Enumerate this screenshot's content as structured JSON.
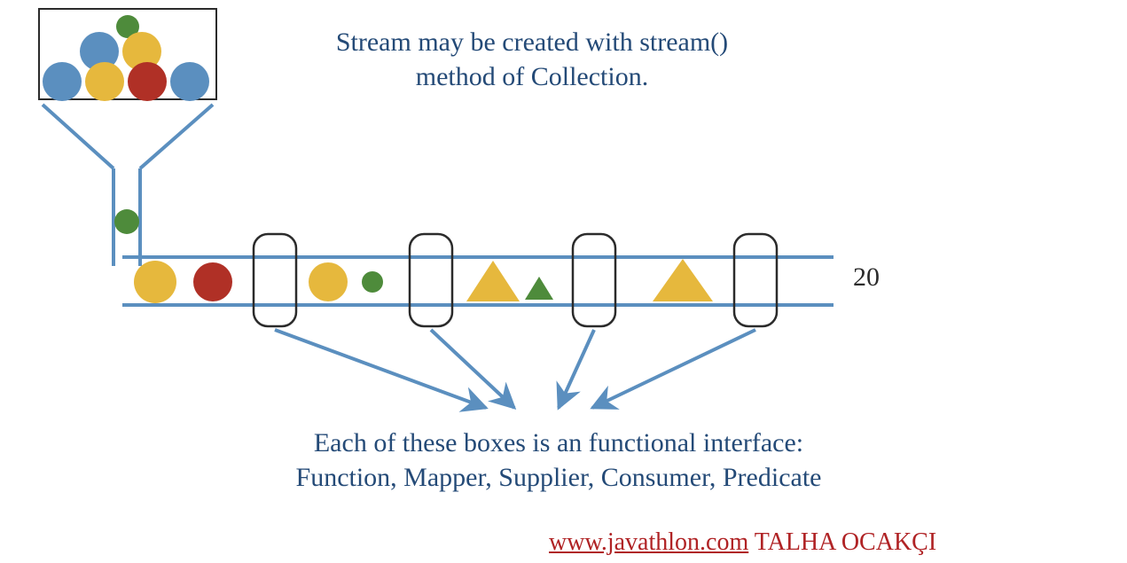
{
  "notes": {
    "top_line1": "Stream may be created with stream()",
    "top_line2": "method of Collection.",
    "bottom_line1": "Each of these boxes is an functional interface:",
    "bottom_line2": "Function, Mapper, Supplier, Consumer, Predicate"
  },
  "output_value": "20",
  "link": {
    "url_text": "www.javathlon.com",
    "author": "TALHA OCAKÇI"
  },
  "colors": {
    "blue": "#5b8fbf",
    "yellow": "#e6b83d",
    "green": "#4e8b3b",
    "red": "#b03026",
    "ink": "#2b2b2b",
    "text": "#244a77",
    "link": "#b02325"
  },
  "diagram": {
    "description": "A funnel collects colored balls from a box and feeds them into a pipeline of four stages (rounded boxes). Shapes transform along the pipeline (circles → triangles) and a single numeric result emerges at the end.",
    "source_box_balls": [
      {
        "color": "green",
        "size": "small"
      },
      {
        "color": "blue",
        "size": "large"
      },
      {
        "color": "yellow",
        "size": "large"
      },
      {
        "color": "blue",
        "size": "large"
      },
      {
        "color": "yellow",
        "size": "large"
      },
      {
        "color": "red",
        "size": "large"
      },
      {
        "color": "blue",
        "size": "large"
      }
    ],
    "pipeline_segments": [
      {
        "before_stage": [
          "yellow-circle-large",
          "red-circle-large"
        ]
      },
      {
        "before_stage": [
          "yellow-circle-large",
          "green-circle-small"
        ]
      },
      {
        "before_stage": [
          "yellow-triangle-large",
          "green-triangle-small"
        ]
      },
      {
        "before_stage": [
          "yellow-triangle-large"
        ]
      }
    ],
    "stage_count": 4
  }
}
